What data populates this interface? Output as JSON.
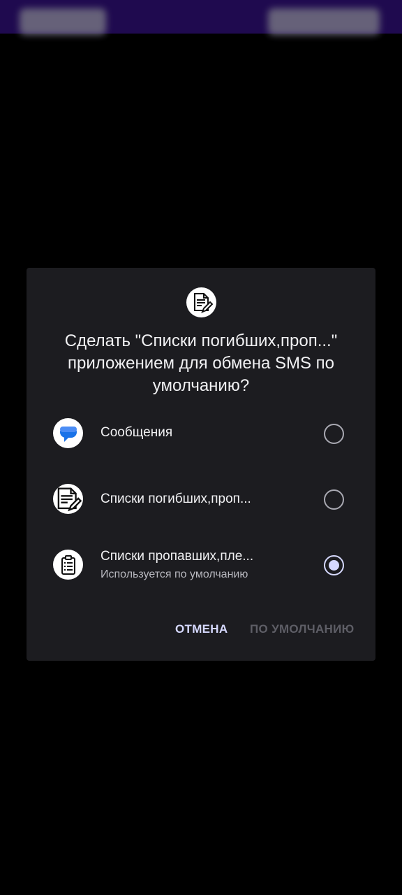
{
  "dialog": {
    "title": "Сделать \"Списки погибших,проп...\" приложением для обмена SMS по умолчанию?",
    "header_icon": "document-edit-icon",
    "options": [
      {
        "label": "Сообщения",
        "subtitle": "",
        "icon": "messages-icon",
        "selected": false
      },
      {
        "label": "Списки погибших,проп...",
        "subtitle": "",
        "icon": "document-edit-icon",
        "selected": false
      },
      {
        "label": "Списки пропавших,пле...",
        "subtitle": "Используется по умолчанию",
        "icon": "clipboard-list-icon",
        "selected": true
      }
    ],
    "buttons": {
      "cancel": "ОТМЕНА",
      "set_default": "ПО УМОЛЧАНИЮ"
    }
  },
  "colors": {
    "status_bar": "#1f0a4f",
    "dialog_bg": "#1c1c20",
    "accent": "#d6d9ff",
    "messages_blue": "#1a73e8"
  }
}
